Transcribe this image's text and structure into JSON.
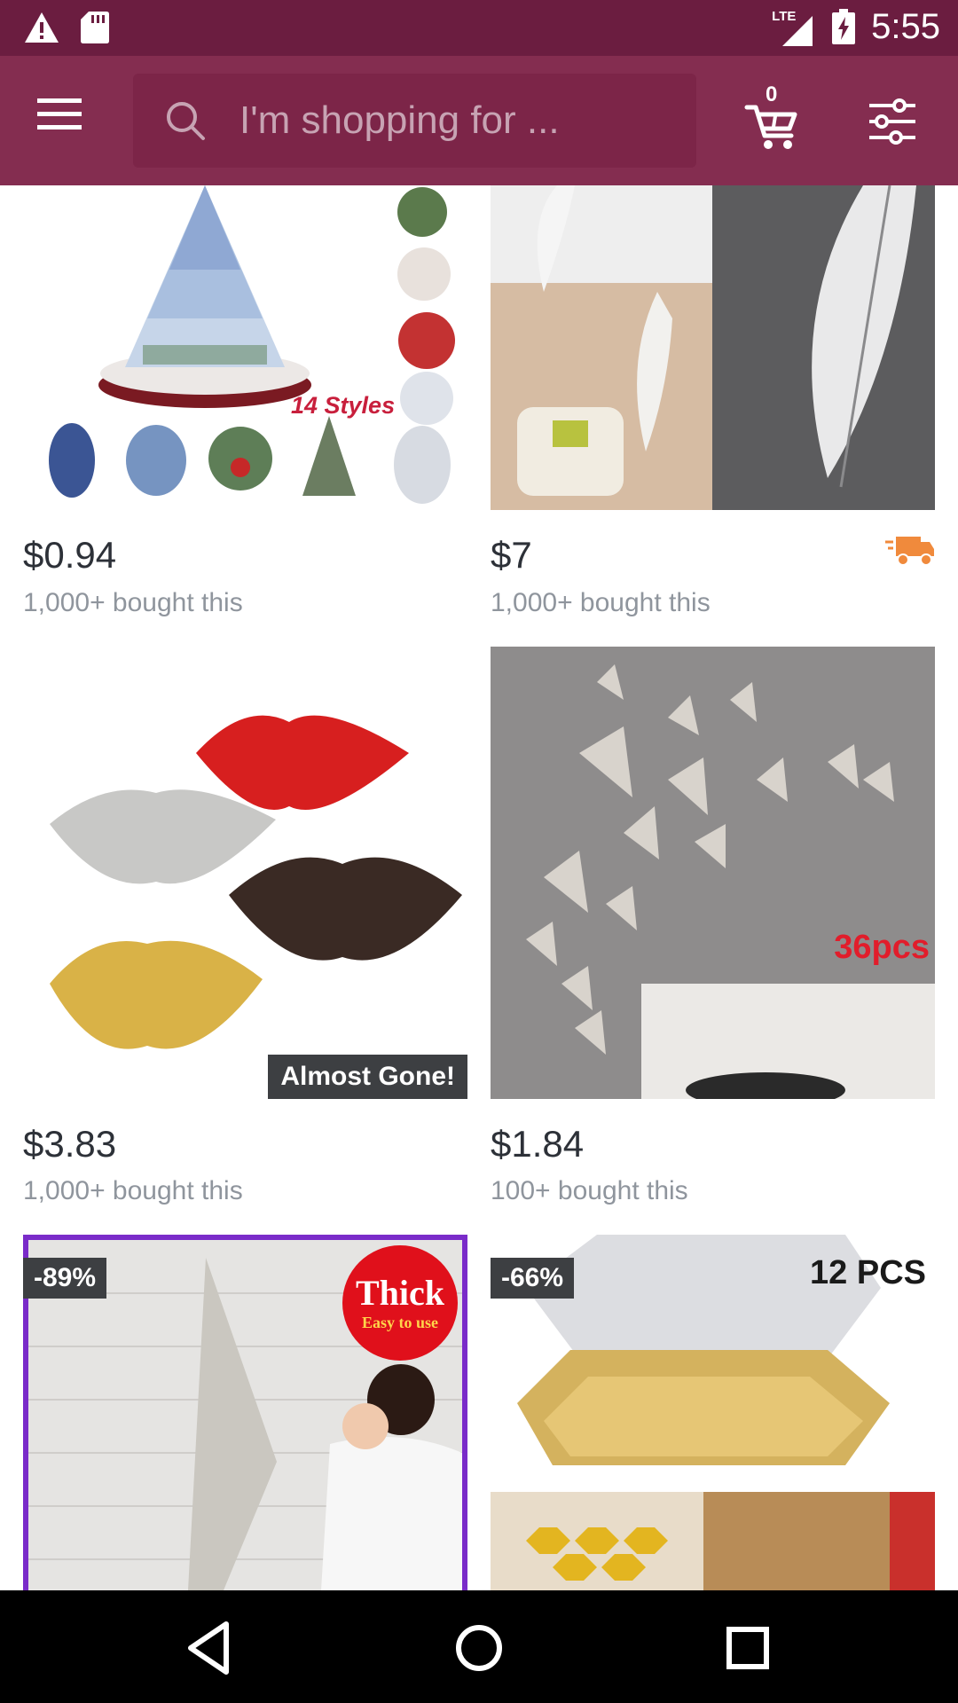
{
  "status_bar": {
    "time": "5:55",
    "network": "LTE",
    "icons": [
      "alert-icon",
      "sd-card-icon",
      "signal-icon",
      "battery-charging-icon"
    ]
  },
  "app_bar": {
    "search_placeholder": "I'm shopping for ...",
    "cart_count": "0",
    "icons": [
      "menu-icon",
      "search-icon",
      "cart-icon",
      "filter-icon"
    ]
  },
  "products": [
    {
      "price": "$0.94",
      "bought": "1,000+ bought this",
      "image_text": "14 Styles"
    },
    {
      "price": "$7",
      "bought": "1,000+ bought this",
      "shipping_icon": "truck-icon"
    },
    {
      "price": "$3.83",
      "bought": "1,000+ bought this",
      "badge": "Almost Gone!"
    },
    {
      "price": "$1.84",
      "bought": "100+ bought this",
      "image_text": "36pcs"
    },
    {
      "discount": "-89%",
      "image_text": "Thick",
      "image_subtext": "Easy to use"
    },
    {
      "discount": "-66%",
      "image_text": "12 PCS"
    }
  ],
  "nav_bar": {
    "icons": [
      "back-icon",
      "home-icon",
      "recents-icon"
    ]
  },
  "colors": {
    "status_bar": "#6b1d40",
    "app_bar": "#842d50",
    "price_text": "#2d3138",
    "secondary_text": "#8f959d",
    "shipping_orange": "#f08a3c"
  }
}
